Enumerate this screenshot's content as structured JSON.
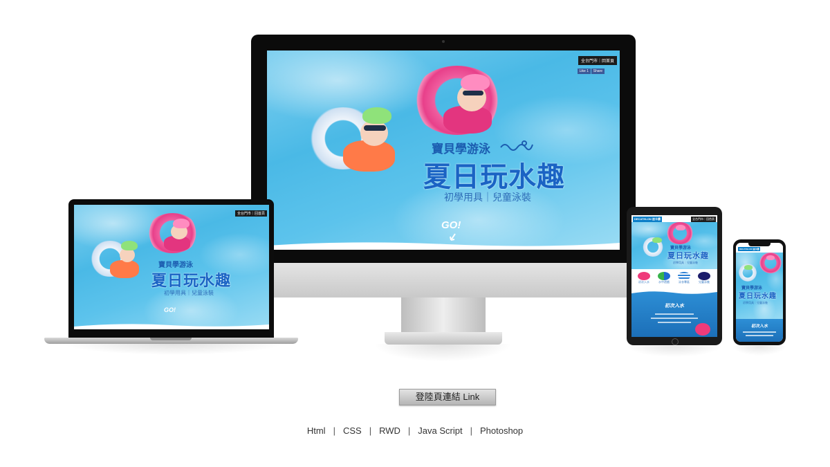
{
  "imac_screen": {
    "menu_label": "全台門市｜回首頁",
    "fb_like": "Like 1",
    "fb_share": "Share",
    "title_small": "寶貝學游泳",
    "title_big": "夏日玩水趣",
    "subtitle": "初學用具｜兒童泳裝",
    "go": "GO!"
  },
  "laptop_screen": {
    "menu_label": "全台門市｜回首頁",
    "title_small": "寶貝學游泳",
    "title_big": "夏日玩水趣",
    "subtitle": "初學用具｜兒童泳裝",
    "go": "GO!"
  },
  "tablet_screen": {
    "logo": "DECATHLON 迪卡儂",
    "menu_label": "全台門市｜回首頁",
    "title_small": "寶貝學游泳",
    "title_big": "夏日玩水趣",
    "subtitle": "初學用具｜兒童泳裝",
    "products": [
      "初次入水",
      "水中遊戲",
      "泳衣專區",
      "兒童泳裝"
    ],
    "section_title": "初次入水"
  },
  "phone_screen": {
    "logo": "DECATHLON 迪卡儂",
    "title_small": "寶貝學游泳",
    "title_big": "夏日玩水趣",
    "subtitle": "初學用具｜兒童泳裝",
    "section_title": "初次入水"
  },
  "link_button": "登陸頁連結  Link",
  "tech_stack": [
    "Html",
    "CSS",
    "RWD",
    "Java Script",
    "Photoshop"
  ],
  "colors": {
    "pool": "#4ab9e6",
    "title_blue": "#1a63c4",
    "brand_blue": "#0b7ec7",
    "button_grey": "#c8c8c8"
  }
}
